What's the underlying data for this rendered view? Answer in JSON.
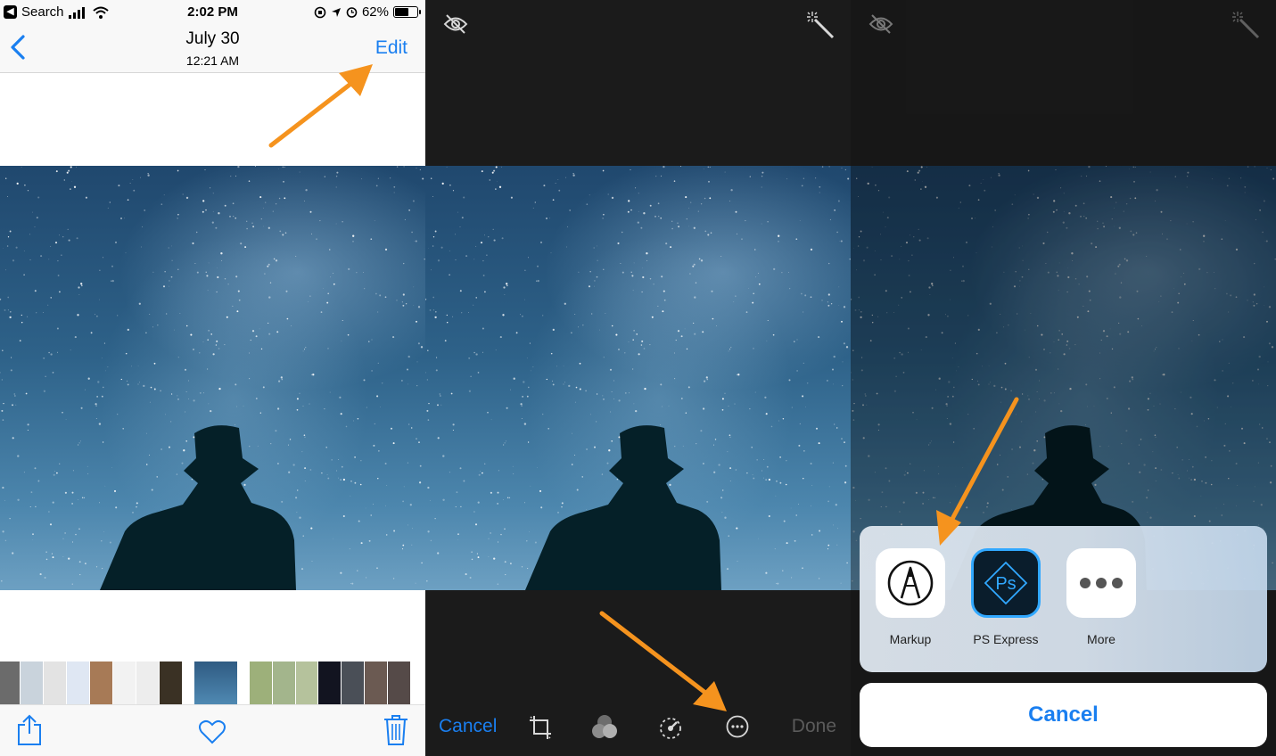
{
  "status_bar": {
    "back_app": "Search",
    "time": "2:02 PM",
    "battery_percent": "62%",
    "battery_level": 0.62
  },
  "nav": {
    "date": "July 30",
    "time": "12:21 AM",
    "edit_label": "Edit",
    "back_icon": "chevron-left-icon"
  },
  "viewer_toolbar": {
    "icons": [
      "share-icon",
      "heart-icon",
      "trash-icon"
    ]
  },
  "edit_toolbar": {
    "cancel_label": "Cancel",
    "done_label": "Done",
    "icons": [
      "crop-icon",
      "filters-icon",
      "adjust-icon",
      "more-icon"
    ],
    "top_icons": [
      "live-photo-off-icon",
      "auto-enhance-icon"
    ]
  },
  "share_sheet": {
    "apps": [
      {
        "label": "Markup",
        "icon": "markup-icon"
      },
      {
        "label": "PS Express",
        "icon": "ps-express-icon"
      },
      {
        "label": "More",
        "icon": "more-dots-icon"
      }
    ],
    "cancel_label": "Cancel"
  },
  "colors": {
    "ios_blue": "#1a7ff0",
    "annotation_arrow": "#f5931e",
    "ps_express_bg": "#0a1d2c",
    "ps_express_accent": "#31a8ff"
  }
}
